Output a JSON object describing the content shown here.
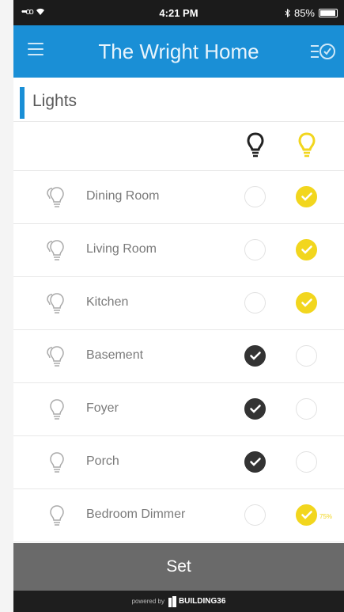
{
  "status_bar": {
    "time": "4:21 PM",
    "battery": "85%",
    "signal": "•••oo"
  },
  "header": {
    "title": "The Wright Home"
  },
  "section": {
    "title": "Lights"
  },
  "rooms": [
    {
      "name": "Dining Room",
      "state": "on",
      "bulb_type": "multi"
    },
    {
      "name": "Living Room",
      "state": "on",
      "bulb_type": "multi"
    },
    {
      "name": "Kitchen",
      "state": "on",
      "bulb_type": "multi"
    },
    {
      "name": "Basement",
      "state": "off",
      "bulb_type": "multi"
    },
    {
      "name": "Foyer",
      "state": "off",
      "bulb_type": "single"
    },
    {
      "name": "Porch",
      "state": "off",
      "bulb_type": "single"
    },
    {
      "name": "Bedroom Dimmer",
      "state": "on",
      "bulb_type": "single",
      "dim_level": "75%"
    }
  ],
  "actions": {
    "set_label": "Set"
  },
  "footer": {
    "powered_by": "powered by",
    "brand": "BUILDING36"
  },
  "colors": {
    "accent": "#1a8fd6",
    "on": "#f2d61e",
    "off": "#333333",
    "set_button": "#6a6a6a"
  }
}
